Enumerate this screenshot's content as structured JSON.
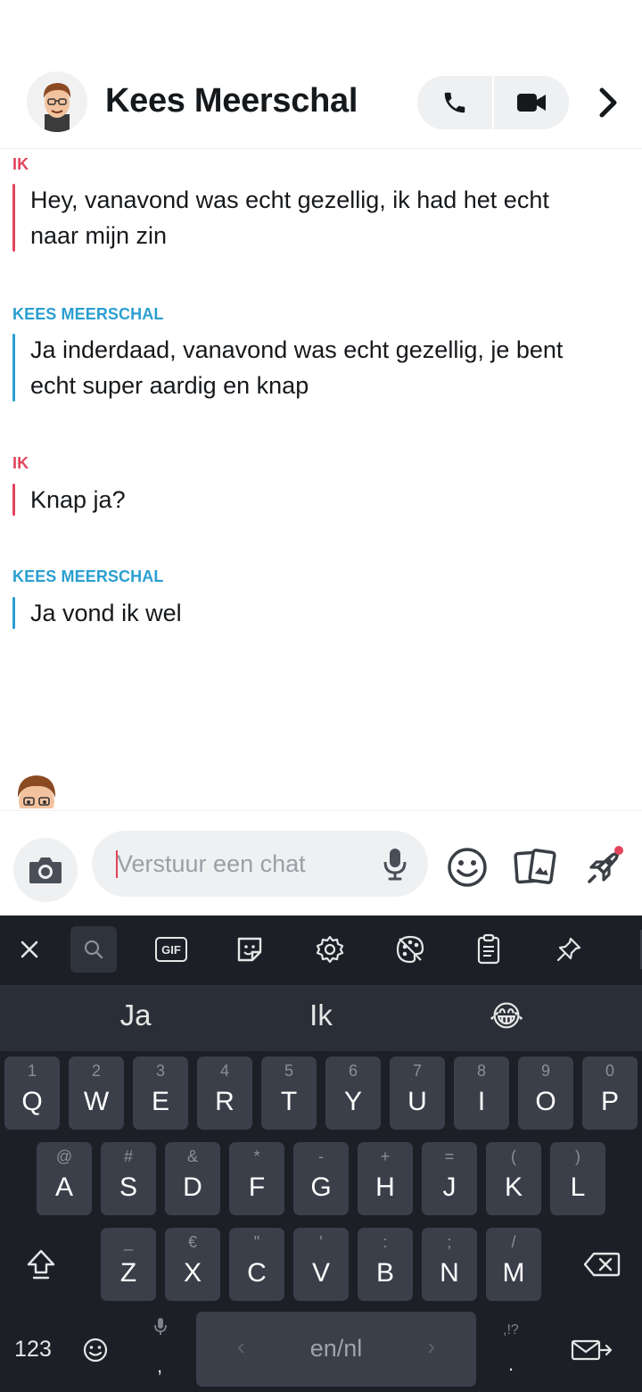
{
  "header": {
    "contact_name": "Kees Meerschal"
  },
  "messages": [
    {
      "sender": "IK",
      "from": "me",
      "text_lines": [
        "Hey, vanavond was echt gezellig, ik had het echt",
        "naar mijn zin"
      ]
    },
    {
      "sender": "KEES MEERSCHAL",
      "from": "them",
      "text_lines": [
        "Ja inderdaad, vanavond was echt gezellig, je bent",
        "echt super aardig en knap"
      ]
    },
    {
      "sender": "IK",
      "from": "me",
      "text_lines": [
        "Knap ja?"
      ]
    },
    {
      "sender": "KEES MEERSCHAL",
      "from": "them",
      "text_lines": [
        "Ja vond ik wel"
      ]
    }
  ],
  "composer": {
    "placeholder": "Verstuur een chat"
  },
  "keyboard": {
    "suggestions": [
      "Ja",
      "Ik",
      "😂"
    ],
    "toolbar": {
      "gif_label": "GIF"
    },
    "rows": [
      {
        "keys": [
          {
            "hint": "1",
            "main": "Q"
          },
          {
            "hint": "2",
            "main": "W"
          },
          {
            "hint": "3",
            "main": "E"
          },
          {
            "hint": "4",
            "main": "R"
          },
          {
            "hint": "5",
            "main": "T"
          },
          {
            "hint": "6",
            "main": "Y"
          },
          {
            "hint": "7",
            "main": "U"
          },
          {
            "hint": "8",
            "main": "I"
          },
          {
            "hint": "9",
            "main": "O"
          },
          {
            "hint": "0",
            "main": "P"
          }
        ]
      },
      {
        "keys": [
          {
            "hint": "@",
            "main": "A"
          },
          {
            "hint": "#",
            "main": "S"
          },
          {
            "hint": "&",
            "main": "D"
          },
          {
            "hint": "*",
            "main": "F"
          },
          {
            "hint": "-",
            "main": "G"
          },
          {
            "hint": "+",
            "main": "H"
          },
          {
            "hint": "=",
            "main": "J"
          },
          {
            "hint": "(",
            "main": "K"
          },
          {
            "hint": ")",
            "main": "L"
          }
        ]
      },
      {
        "keys": [
          {
            "hint": "_",
            "main": "Z"
          },
          {
            "hint": "€",
            "main": "X"
          },
          {
            "hint": "\"",
            "main": "C"
          },
          {
            "hint": "'",
            "main": "V"
          },
          {
            "hint": ":",
            "main": "B"
          },
          {
            "hint": ";",
            "main": "N"
          },
          {
            "hint": "/",
            "main": "M"
          }
        ]
      }
    ],
    "numbers_label": "123",
    "comma_label": ",",
    "space_label": "en/nl",
    "period_hint": ",!?",
    "period_label": "."
  }
}
